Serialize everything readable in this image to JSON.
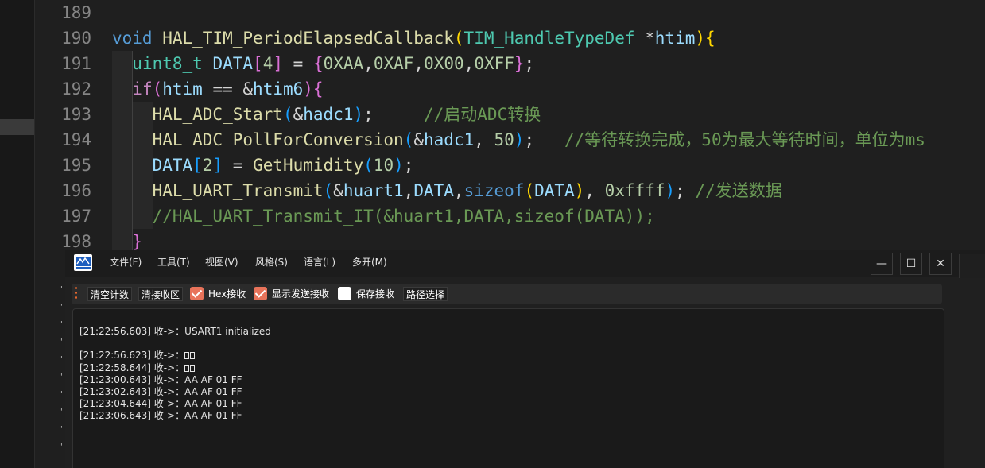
{
  "editor": {
    "lines": [
      {
        "num": "189",
        "tokens": []
      },
      {
        "num": "190",
        "tokens": [
          {
            "t": "void",
            "c": "t-kw"
          },
          {
            "t": " ",
            "c": ""
          },
          {
            "t": "HAL_TIM_PeriodElapsedCallback",
            "c": "t-fn"
          },
          {
            "t": "(",
            "c": "t-p1"
          },
          {
            "t": "TIM_HandleTypeDef",
            "c": "t-type"
          },
          {
            "t": " *",
            "c": "t-op"
          },
          {
            "t": "htim",
            "c": "t-var"
          },
          {
            "t": ")",
            "c": "t-p1"
          },
          {
            "t": "{",
            "c": "t-p1"
          }
        ]
      },
      {
        "num": "191",
        "tokens": [
          {
            "t": "  ",
            "c": ""
          },
          {
            "t": "uint8_t",
            "c": "t-type"
          },
          {
            "t": " ",
            "c": ""
          },
          {
            "t": "DATA",
            "c": "t-var"
          },
          {
            "t": "[",
            "c": "t-p2"
          },
          {
            "t": "4",
            "c": "t-num"
          },
          {
            "t": "]",
            "c": "t-p2"
          },
          {
            "t": " = ",
            "c": "t-op"
          },
          {
            "t": "{",
            "c": "t-p2"
          },
          {
            "t": "0XAA",
            "c": "t-num"
          },
          {
            "t": ",",
            "c": "t-op"
          },
          {
            "t": "0XAF",
            "c": "t-num"
          },
          {
            "t": ",",
            "c": "t-op"
          },
          {
            "t": "0X00",
            "c": "t-num"
          },
          {
            "t": ",",
            "c": "t-op"
          },
          {
            "t": "0XFF",
            "c": "t-num"
          },
          {
            "t": "}",
            "c": "t-p2"
          },
          {
            "t": ";",
            "c": "t-op"
          }
        ]
      },
      {
        "num": "192",
        "tokens": [
          {
            "t": "  ",
            "c": ""
          },
          {
            "t": "if",
            "c": "t-ctrl"
          },
          {
            "t": "(",
            "c": "t-p2"
          },
          {
            "t": "htim",
            "c": "t-var"
          },
          {
            "t": " == &",
            "c": "t-op"
          },
          {
            "t": "htim6",
            "c": "t-var"
          },
          {
            "t": ")",
            "c": "t-p2"
          },
          {
            "t": "{",
            "c": "t-p2"
          }
        ]
      },
      {
        "num": "193",
        "tokens": [
          {
            "t": "    ",
            "c": ""
          },
          {
            "t": "HAL_ADC_Start",
            "c": "t-fn"
          },
          {
            "t": "(",
            "c": "t-p3"
          },
          {
            "t": "&",
            "c": "t-op"
          },
          {
            "t": "hadc1",
            "c": "t-var"
          },
          {
            "t": ")",
            "c": "t-p3"
          },
          {
            "t": ";     ",
            "c": "t-op"
          },
          {
            "t": "//启动ADC转换",
            "c": "t-cmt"
          }
        ]
      },
      {
        "num": "194",
        "tokens": [
          {
            "t": "    ",
            "c": ""
          },
          {
            "t": "HAL_ADC_PollForConversion",
            "c": "t-fn"
          },
          {
            "t": "(",
            "c": "t-p3"
          },
          {
            "t": "&",
            "c": "t-op"
          },
          {
            "t": "hadc1",
            "c": "t-var"
          },
          {
            "t": ", ",
            "c": "t-op"
          },
          {
            "t": "50",
            "c": "t-num"
          },
          {
            "t": ")",
            "c": "t-p3"
          },
          {
            "t": ";   ",
            "c": "t-op"
          },
          {
            "t": "//等待转换完成，50为最大等待时间，单位为ms",
            "c": "t-cmt"
          }
        ]
      },
      {
        "num": "195",
        "tokens": [
          {
            "t": "    ",
            "c": ""
          },
          {
            "t": "DATA",
            "c": "t-var"
          },
          {
            "t": "[",
            "c": "t-p3"
          },
          {
            "t": "2",
            "c": "t-num"
          },
          {
            "t": "]",
            "c": "t-p3"
          },
          {
            "t": " = ",
            "c": "t-op"
          },
          {
            "t": "GetHumidity",
            "c": "t-fn"
          },
          {
            "t": "(",
            "c": "t-p3"
          },
          {
            "t": "10",
            "c": "t-num"
          },
          {
            "t": ")",
            "c": "t-p3"
          },
          {
            "t": ";",
            "c": "t-op"
          }
        ]
      },
      {
        "num": "196",
        "tokens": [
          {
            "t": "    ",
            "c": ""
          },
          {
            "t": "HAL_UART_Transmit",
            "c": "t-fn"
          },
          {
            "t": "(",
            "c": "t-p3"
          },
          {
            "t": "&",
            "c": "t-op"
          },
          {
            "t": "huart1",
            "c": "t-var"
          },
          {
            "t": ",",
            "c": "t-op"
          },
          {
            "t": "DATA",
            "c": "t-var"
          },
          {
            "t": ",",
            "c": "t-op"
          },
          {
            "t": "sizeof",
            "c": "t-kw"
          },
          {
            "t": "(",
            "c": "t-p1"
          },
          {
            "t": "DATA",
            "c": "t-var"
          },
          {
            "t": ")",
            "c": "t-p1"
          },
          {
            "t": ", ",
            "c": "t-op"
          },
          {
            "t": "0xffff",
            "c": "t-num"
          },
          {
            "t": ")",
            "c": "t-p3"
          },
          {
            "t": "; ",
            "c": "t-op"
          },
          {
            "t": "//发送数据",
            "c": "t-cmt"
          }
        ]
      },
      {
        "num": "197",
        "tokens": [
          {
            "t": "    ",
            "c": ""
          },
          {
            "t": "//HAL_UART_Transmit_IT(&huart1,DATA,sizeof(DATA));",
            "c": "t-cmt"
          }
        ]
      },
      {
        "num": "198",
        "tokens": [
          {
            "t": "  ",
            "c": ""
          },
          {
            "t": "}",
            "c": "t-p2"
          }
        ]
      }
    ]
  },
  "serial": {
    "menu": [
      "文件(F)",
      "工具(T)",
      "视图(V)",
      "风格(S)",
      "语言(L)",
      "多开(M)"
    ],
    "window_controls": {
      "minimize": "—",
      "maximize": "☐",
      "close": "✕"
    },
    "toolbar": {
      "clear_count": "清空计数",
      "clear_recv": "清接收区",
      "hex_recv": "Hex接收",
      "hex_recv_checked": true,
      "show_send": "显示发送接收",
      "show_send_checked": true,
      "save_recv": "保存接收",
      "save_recv_checked": false,
      "path_select": "路径选择"
    },
    "recv_lines": [
      {
        "text": "[21:22:56.603] 收->：USART1 initialized",
        "garbled": false
      },
      {
        "text": "",
        "garbled": false
      },
      {
        "text": "[21:22:56.623] 收->：",
        "garbled": true
      },
      {
        "text": "[21:22:58.644] 收->：",
        "garbled": true
      },
      {
        "text": "[21:23:00.643] 收->：AA AF 01 FF",
        "garbled": false
      },
      {
        "text": "[21:23:02.643] 收->：AA AF 01 FF",
        "garbled": false
      },
      {
        "text": "[21:23:04.644] 收->：AA AF 01 FF",
        "garbled": false
      },
      {
        "text": "[21:23:06.643] 收->：AA AF 01 FF",
        "garbled": false
      }
    ]
  },
  "colors": {
    "accent_check": "#e8735a",
    "editor_bg": "#1f1f1f",
    "comment": "#6a9955"
  }
}
